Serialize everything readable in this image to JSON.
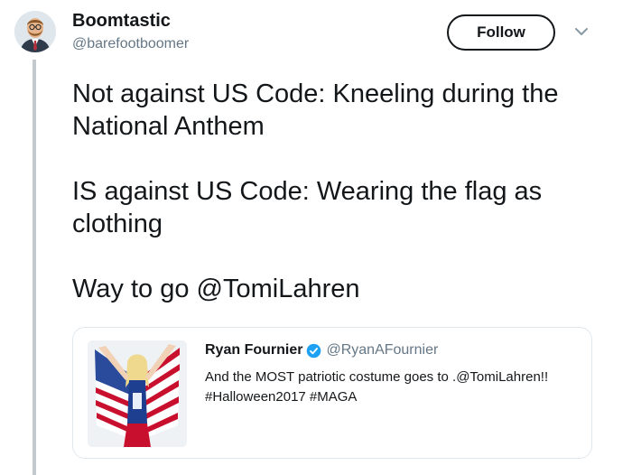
{
  "tweet": {
    "author": {
      "display_name": "Boomtastic",
      "handle": "@barefootboomer"
    },
    "follow_label": "Follow",
    "paragraphs": [
      "Not against US Code: Kneeling during the National Anthem",
      "IS against US Code: Wearing the flag as clothing",
      "Way to go @TomiLahren"
    ]
  },
  "quoted_tweet": {
    "display_name": "Ryan Fournier",
    "handle": "@RyanAFournier",
    "verified": true,
    "text": "And the MOST patriotic costume goes to .@TomiLahren!! #Halloween2017 #MAGA"
  },
  "icons": {
    "avatar": "bitmoji-avatar",
    "chevron": "chevron-down-icon",
    "verified": "verified-badge-icon"
  },
  "colors": {
    "text_primary": "#14171a",
    "text_secondary": "#657786",
    "verified_blue": "#1da1f2",
    "thread_line": "#c4c9ce",
    "card_border": "#e1e8ed"
  }
}
